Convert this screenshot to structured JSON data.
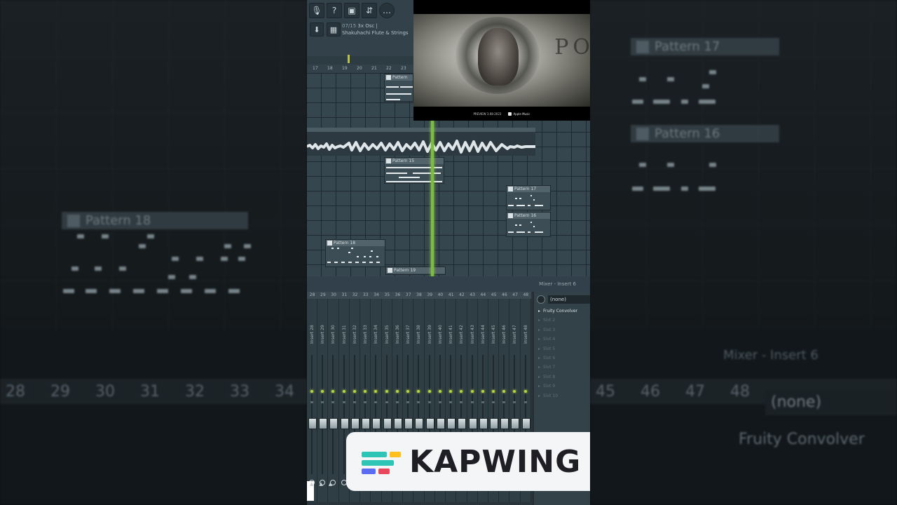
{
  "background": {
    "ghost_patterns": [
      "Pattern 17",
      "Pattern 16",
      "Pattern 18"
    ],
    "ghost_mixer_title": "Mixer - Insert 6",
    "ghost_fx_selected": "(none)",
    "ghost_fx_slot": "Fruity Convolver"
  },
  "toolbar": {
    "buttons": [
      "mic-icon",
      "help-icon",
      "save-icon",
      "render-icon",
      "chat-icon"
    ],
    "info_number": "07/15",
    "info_line1": "3x Osc |",
    "info_line2": "Shakuhachi Flute & Strings"
  },
  "ruler": {
    "marks": [
      "17",
      "18",
      "19",
      "20",
      "21",
      "22",
      "23"
    ]
  },
  "video": {
    "partial_title": "PO",
    "caption_left": "PREVIEW 3.08-2023",
    "caption_brand": "Apple Music"
  },
  "playlist": {
    "patterns": [
      {
        "label": "Pattern"
      },
      {
        "label": "Pattern 15"
      },
      {
        "label": "Pattern 17"
      },
      {
        "label": "Pattern 16"
      },
      {
        "label": "Pattern 18"
      },
      {
        "label": "Pattern 19"
      }
    ]
  },
  "mixer": {
    "title": "Mixer - Insert 6",
    "numbers": [
      "28",
      "29",
      "30",
      "31",
      "32",
      "33",
      "34",
      "35",
      "36",
      "37",
      "38",
      "39",
      "40",
      "41",
      "42",
      "43",
      "44",
      "45",
      "46",
      "47",
      "48"
    ],
    "strip_names": [
      "Insert 28",
      "Insert 29",
      "Insert 30",
      "Insert 31",
      "Insert 32",
      "Insert 33",
      "Insert 34",
      "Insert 35",
      "Insert 36",
      "Insert 37",
      "Insert 38",
      "Insert 39",
      "Insert 40",
      "Insert 41",
      "Insert 42",
      "Insert 43",
      "Insert 44",
      "Insert 45",
      "Insert 46",
      "Insert 47",
      "Insert 48"
    ],
    "fx_selected": "(none)",
    "fx_slots": [
      "Fruity Convolver",
      "Slot 2",
      "Slot 3",
      "Slot 4",
      "Slot 5",
      "Slot 6",
      "Slot 7",
      "Slot 8",
      "Slot 9",
      "Slot 10"
    ]
  },
  "watermark": {
    "brand": "KAPWING",
    "colors": [
      "#2ec4b6",
      "#ffbf1f",
      "#e8485a",
      "#5a6cf0"
    ]
  }
}
